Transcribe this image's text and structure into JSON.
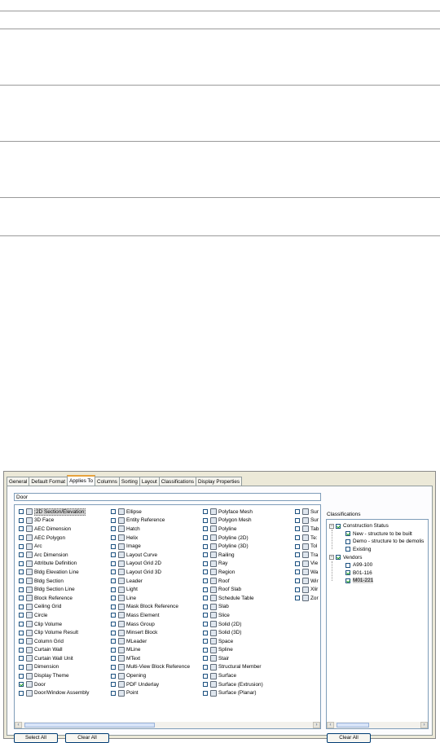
{
  "tabs": [
    "General",
    "Default Format",
    "Applies To",
    "Columns",
    "Sorting",
    "Layout",
    "Classifications",
    "Display Properties"
  ],
  "active_tab": "Applies To",
  "filter_value": "Door",
  "columns": [
    [
      {
        "label": "2D Section/Elevation",
        "checked": false,
        "selected": true,
        "icon": "section-icon"
      },
      {
        "label": "3D Face",
        "checked": false,
        "icon": "face-icon"
      },
      {
        "label": "AEC Dimension",
        "checked": false,
        "icon": "dimension-icon"
      },
      {
        "label": "AEC Polygon",
        "checked": false,
        "icon": "polygon-icon"
      },
      {
        "label": "Arc",
        "checked": false,
        "icon": "arc-icon"
      },
      {
        "label": "Arc Dimension",
        "checked": false,
        "icon": "arc-dimension-icon"
      },
      {
        "label": "Attribute Definition",
        "checked": false,
        "icon": "attribute-icon"
      },
      {
        "label": "Bldg Elevation Line",
        "checked": false,
        "icon": "elevation-line-icon"
      },
      {
        "label": "Bldg Section",
        "checked": false,
        "icon": "bldg-section-icon"
      },
      {
        "label": "Bldg Section Line",
        "checked": false,
        "icon": "section-line-icon"
      },
      {
        "label": "Block Reference",
        "checked": false,
        "icon": "block-icon"
      },
      {
        "label": "Ceiling Grid",
        "checked": false,
        "icon": "grid-icon"
      },
      {
        "label": "Circle",
        "checked": false,
        "icon": "circle-icon"
      },
      {
        "label": "Clip Volume",
        "checked": false,
        "icon": "clip-volume-icon"
      },
      {
        "label": "Clip Volume Result",
        "checked": false,
        "icon": "clip-result-icon"
      },
      {
        "label": "Column Grid",
        "checked": false,
        "icon": "column-grid-icon"
      },
      {
        "label": "Curtain Wall",
        "checked": false,
        "icon": "curtain-wall-icon"
      },
      {
        "label": "Curtain Wall Unit",
        "checked": false,
        "icon": "curtain-unit-icon"
      },
      {
        "label": "Dimension",
        "checked": false,
        "icon": "dimension-icon"
      },
      {
        "label": "Display Theme",
        "checked": false,
        "icon": "theme-icon"
      },
      {
        "label": "Door",
        "checked": true,
        "icon": "door-icon"
      },
      {
        "label": "Door/Window Assembly",
        "checked": false,
        "icon": "assembly-icon"
      }
    ],
    [
      {
        "label": "Ellipse",
        "checked": false,
        "icon": "ellipse-icon"
      },
      {
        "label": "Entity Reference",
        "checked": false,
        "icon": "entity-icon"
      },
      {
        "label": "Hatch",
        "checked": false,
        "icon": "hatch-icon"
      },
      {
        "label": "Helix",
        "checked": false,
        "icon": "helix-icon"
      },
      {
        "label": "Image",
        "checked": false,
        "icon": "image-icon"
      },
      {
        "label": "Layout Curve",
        "checked": false,
        "icon": "layout-curve-icon"
      },
      {
        "label": "Layout Grid 2D",
        "checked": false,
        "icon": "layout-grid-icon"
      },
      {
        "label": "Layout Grid 3D",
        "checked": false,
        "icon": "layout-grid-icon"
      },
      {
        "label": "Leader",
        "checked": false,
        "icon": "leader-icon"
      },
      {
        "label": "Light",
        "checked": false,
        "icon": "light-icon"
      },
      {
        "label": "Line",
        "checked": false,
        "icon": "line-icon"
      },
      {
        "label": "Mask Block Reference",
        "checked": false,
        "icon": "mask-block-icon"
      },
      {
        "label": "Mass Element",
        "checked": false,
        "icon": "mass-element-icon"
      },
      {
        "label": "Mass Group",
        "checked": false,
        "icon": "mass-group-icon"
      },
      {
        "label": "Minsert Block",
        "checked": false,
        "icon": "minsert-icon"
      },
      {
        "label": "MLeader",
        "checked": false,
        "icon": "mleader-icon"
      },
      {
        "label": "MLine",
        "checked": false,
        "icon": "mline-icon"
      },
      {
        "label": "MText",
        "checked": false,
        "icon": "mtext-icon"
      },
      {
        "label": "Multi-View Block Reference",
        "checked": false,
        "icon": "mvblock-icon"
      },
      {
        "label": "Opening",
        "checked": false,
        "icon": "opening-icon"
      },
      {
        "label": "PDF Underlay",
        "checked": false,
        "icon": "pdf-icon"
      },
      {
        "label": "Point",
        "checked": false,
        "icon": "point-icon"
      }
    ],
    [
      {
        "label": "Polyface Mesh",
        "checked": false,
        "icon": "polyface-icon"
      },
      {
        "label": "Polygon Mesh",
        "checked": false,
        "icon": "polygon-mesh-icon"
      },
      {
        "label": "Polyline",
        "checked": false,
        "icon": "polyline-icon"
      },
      {
        "label": "Polyline (2D)",
        "checked": false,
        "icon": "polyline-icon"
      },
      {
        "label": "Polyline (3D)",
        "checked": false,
        "icon": "polyline-icon"
      },
      {
        "label": "Railing",
        "checked": false,
        "icon": "railing-icon"
      },
      {
        "label": "Ray",
        "checked": false,
        "icon": "ray-icon"
      },
      {
        "label": "Region",
        "checked": false,
        "icon": "region-icon"
      },
      {
        "label": "Roof",
        "checked": false,
        "icon": "roof-icon"
      },
      {
        "label": "Roof Slab",
        "checked": false,
        "icon": "roof-slab-icon"
      },
      {
        "label": "Schedule Table",
        "checked": false,
        "icon": "table-icon"
      },
      {
        "label": "Slab",
        "checked": false,
        "icon": "slab-icon"
      },
      {
        "label": "Slice",
        "checked": false,
        "icon": "slice-icon"
      },
      {
        "label": "Solid (2D)",
        "checked": false,
        "icon": "solid-icon"
      },
      {
        "label": "Solid (3D)",
        "checked": false,
        "icon": "solid-icon"
      },
      {
        "label": "Space",
        "checked": false,
        "icon": "space-icon"
      },
      {
        "label": "Spline",
        "checked": false,
        "icon": "spline-icon"
      },
      {
        "label": "Stair",
        "checked": false,
        "icon": "stair-icon"
      },
      {
        "label": "Structural Member",
        "checked": false,
        "icon": "member-icon"
      },
      {
        "label": "Surface",
        "checked": false,
        "icon": "surface-icon"
      },
      {
        "label": "Surface (Extrusion)",
        "checked": false,
        "icon": "surface-icon"
      },
      {
        "label": "Surface (Planar)",
        "checked": false,
        "icon": "surface-icon"
      }
    ],
    [
      {
        "label": "Sur",
        "checked": false,
        "icon": "surface-icon"
      },
      {
        "label": "Sur",
        "checked": false,
        "icon": "surface-icon"
      },
      {
        "label": "Tab",
        "checked": false,
        "icon": "table-icon"
      },
      {
        "label": "Te:",
        "checked": false,
        "icon": "text-icon"
      },
      {
        "label": "Tol",
        "checked": false,
        "icon": "tolerance-icon"
      },
      {
        "label": "Tra",
        "checked": false,
        "icon": "trace-icon"
      },
      {
        "label": "Vie",
        "checked": false,
        "icon": "viewport-icon"
      },
      {
        "label": "Wa",
        "checked": false,
        "icon": "wall-icon"
      },
      {
        "label": "Wir",
        "checked": false,
        "icon": "window-icon"
      },
      {
        "label": "Xlir",
        "checked": false,
        "icon": "xline-icon"
      },
      {
        "label": "Zor",
        "checked": false,
        "icon": "zone-icon"
      }
    ]
  ],
  "buttons": {
    "select_all": "Select All",
    "clear_all": "Clear All",
    "clear_all_classifications": "Clear All"
  },
  "classifications": {
    "label": "Classifications",
    "tree": [
      {
        "label": "Construction Status",
        "checked": true,
        "expanded": true,
        "children": [
          {
            "label": "New - structure to be built",
            "checked": true
          },
          {
            "label": "Demo - structure to be demolis",
            "checked": false
          },
          {
            "label": "Existing",
            "checked": false
          }
        ]
      },
      {
        "label": "Vendors",
        "checked": true,
        "expanded": true,
        "children": [
          {
            "label": "A99-100",
            "checked": false
          },
          {
            "label": "B01-116",
            "checked": true
          },
          {
            "label": "M01-221",
            "checked": true,
            "selected": true
          }
        ]
      }
    ]
  }
}
